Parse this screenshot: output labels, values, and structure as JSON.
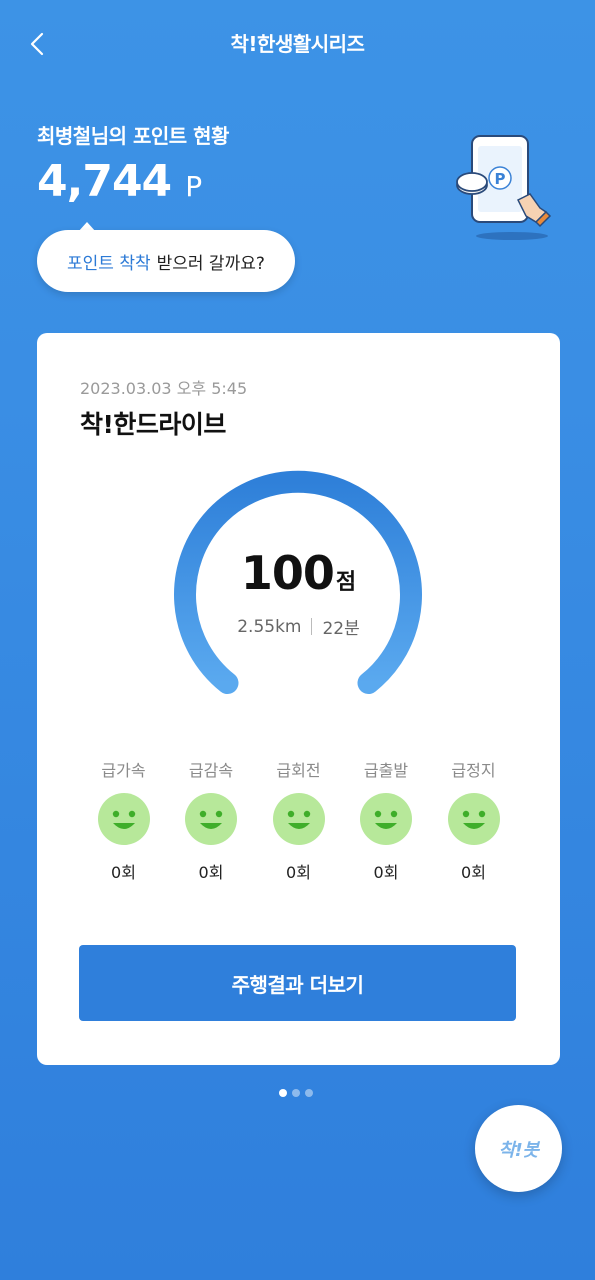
{
  "header": {
    "title": "착!한생활시리즈",
    "back_icon": "chevron-left-icon"
  },
  "points": {
    "label": "최병철님의 포인트 현황",
    "value": "4,744",
    "unit": "P",
    "bubble_highlight": "포인트 착착",
    "bubble_text": "받으러 갈까요?",
    "illustration_icon": "phone-point-icon",
    "illustration_letter": "P"
  },
  "card": {
    "date": "2023.03.03 오후 5:45",
    "title": "착!한드라이브",
    "score": "100",
    "score_unit": "점",
    "distance": "2.55km",
    "duration": "22분",
    "events": [
      {
        "label": "급가속",
        "count": "0회"
      },
      {
        "label": "급감속",
        "count": "0회"
      },
      {
        "label": "급회전",
        "count": "0회"
      },
      {
        "label": "급출발",
        "count": "0회"
      },
      {
        "label": "급정지",
        "count": "0회"
      }
    ],
    "result_button": "주행결과 더보기"
  },
  "pagination": {
    "total": 3,
    "active": 1
  },
  "chatbot": {
    "label": "착!봇"
  },
  "colors": {
    "background": "#3a8ee4",
    "accent": "#2f7fdb",
    "face": "#b7e89a",
    "face_feature": "#3fae2a"
  }
}
